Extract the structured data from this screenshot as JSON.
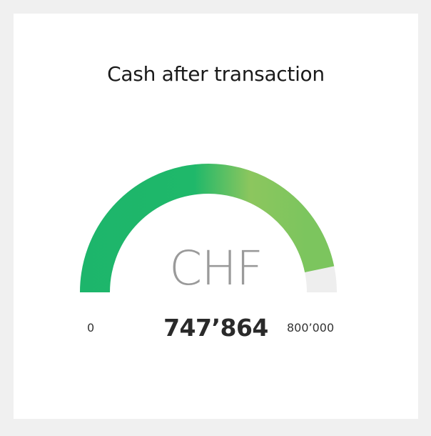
{
  "card": {
    "title": "Cash after transaction",
    "unit": "CHF",
    "value_label": "747’864",
    "min_label": "0",
    "max_label": "800’000"
  },
  "gauge": {
    "min": 0,
    "max": 800000,
    "value": 747864,
    "fill_color_start": "#1db56b",
    "fill_color_end": "#8cc65e",
    "track_color": "#eeeeee"
  }
}
